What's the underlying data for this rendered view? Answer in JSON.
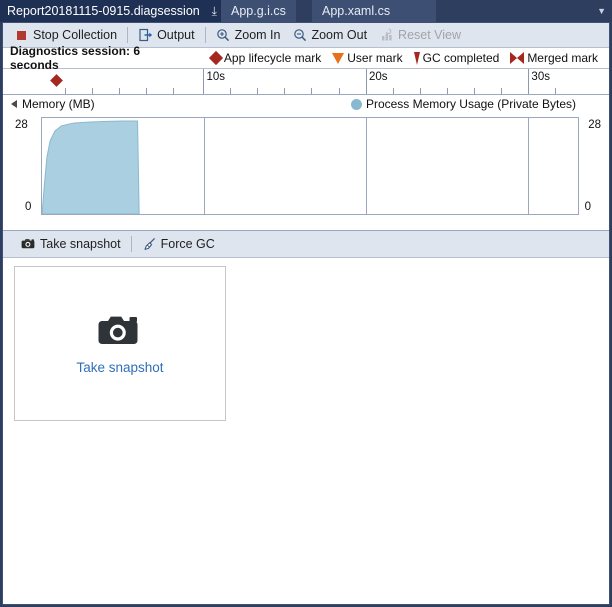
{
  "window": {
    "title": "Report20181115-0915.diagsession"
  },
  "tabs": {
    "items": [
      {
        "label": "Report20181115-0915.diagsession",
        "active": true
      },
      {
        "label": "App.g.i.cs",
        "active": false
      },
      {
        "label": "App.xaml.cs",
        "active": false
      }
    ],
    "pin_glyph": "⤓",
    "close_glyph": "✕",
    "overflow_glyph": "▼"
  },
  "toolbar": {
    "stop_collection": "Stop Collection",
    "output": "Output",
    "zoom_in": "Zoom In",
    "zoom_out": "Zoom Out",
    "reset_view": "Reset View",
    "reset_view_disabled": true
  },
  "session": {
    "text": "Diagnostics session: 6 seconds",
    "legend": [
      {
        "label": "App lifecycle mark",
        "marker": "diamond-marker",
        "color": "#a5281e"
      },
      {
        "label": "User mark",
        "marker": "triangle-down-marker",
        "color": "#e8701a"
      },
      {
        "label": "GC completed",
        "marker": "gc-marker",
        "color": "#a5281e"
      },
      {
        "label": "Merged mark",
        "marker": "merged-marker",
        "color": "#a5281e"
      }
    ]
  },
  "ruler": {
    "labels": [
      "10s",
      "20s",
      "30s"
    ],
    "label_positions_pct": [
      30.2,
      60.4,
      90.6
    ],
    "minor_ticks_pct": [
      4.5,
      9.5,
      14.5,
      19.5,
      24.5,
      35.2,
      40.2,
      45.2,
      50.2,
      55.3,
      65.4,
      70.4,
      75.4,
      80.5,
      85.5,
      95.6
    ],
    "marker_pct": 2.1,
    "marker_name": "app-lifecycle-mark"
  },
  "memory_chart": {
    "title": "Memory (MB)",
    "legend_label": "Process Memory Usage (Private Bytes)",
    "legend_color": "#8ab8d0",
    "axis_max": "28",
    "axis_min": "0",
    "divider_positions_pct": [
      30.2,
      60.4,
      90.6
    ]
  },
  "chart_data": {
    "type": "area",
    "title": "Memory (MB)",
    "series": [
      {
        "name": "Process Memory Usage (Private Bytes)",
        "color": "#aacfe0",
        "line_color": "#8ab8d0",
        "x": [
          0.0,
          0.15,
          0.3,
          0.5,
          0.8,
          1.2,
          1.6,
          2.0,
          3.0,
          4.0,
          5.0,
          5.9,
          6.0
        ],
        "values": [
          0,
          9,
          17,
          22,
          25,
          26.5,
          27,
          27.4,
          27.7,
          27.9,
          28,
          28,
          0
        ]
      }
    ],
    "xlabel": "",
    "ylabel": "Memory (MB)",
    "xlim": [
      0,
      33.1
    ],
    "ylim": [
      0,
      28
    ],
    "ytick_labels": [
      "28",
      "0"
    ],
    "xtick_labels": [
      "10s",
      "20s",
      "30s"
    ],
    "grid": false,
    "legend_position": "top-right"
  },
  "snapshot_toolbar": {
    "take_snapshot": "Take snapshot",
    "force_gc": "Force GC"
  },
  "snapshot_panel": {
    "take_snapshot": "Take snapshot"
  }
}
